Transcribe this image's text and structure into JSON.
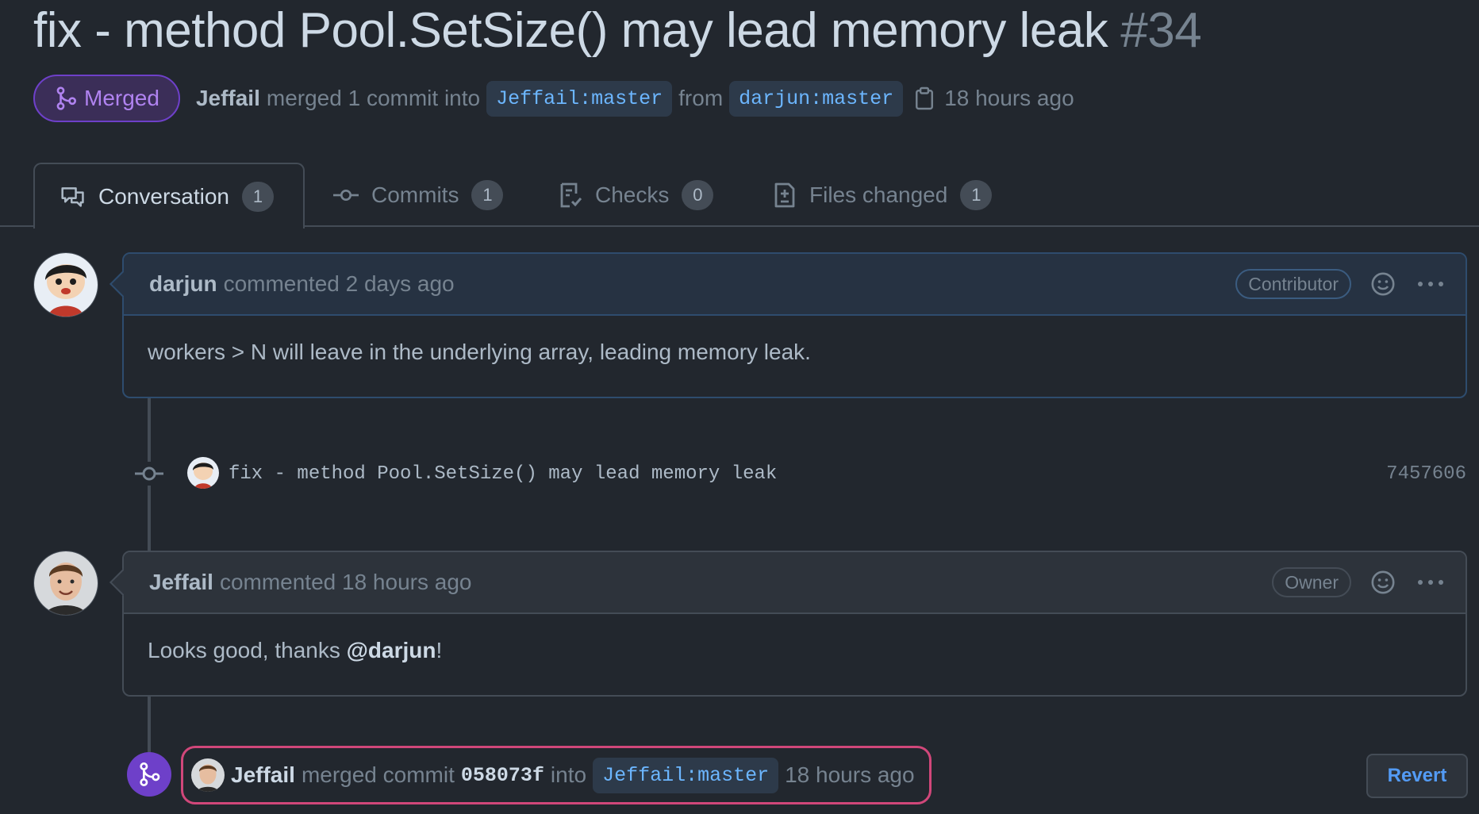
{
  "pr": {
    "title": "fix - method Pool.SetSize() may lead memory leak",
    "number": "#34",
    "state": "Merged",
    "author": "Jeffail",
    "merge_text": "merged 1 commit into",
    "base_branch": "Jeffail:master",
    "from_text": "from",
    "head_branch": "darjun:master",
    "time": "18 hours ago"
  },
  "tabs": [
    {
      "label": "Conversation",
      "count": "1",
      "icon": "comment-discussion-icon"
    },
    {
      "label": "Commits",
      "count": "1",
      "icon": "git-commit-icon"
    },
    {
      "label": "Checks",
      "count": "0",
      "icon": "checklist-icon"
    },
    {
      "label": "Files changed",
      "count": "1",
      "icon": "file-diff-icon"
    }
  ],
  "comments": [
    {
      "author": "darjun",
      "action": "commented 2 days ago",
      "role": "Contributor",
      "body": "workers > N will leave in the underlying array, leading memory leak."
    },
    {
      "author": "Jeffail",
      "action": "commented 18 hours ago",
      "role": "Owner",
      "body_prefix": "Looks good, thanks ",
      "mention": "@darjun",
      "body_suffix": "!"
    }
  ],
  "commit": {
    "message": "fix - method Pool.SetSize() may lead memory leak",
    "sha": "7457606"
  },
  "merge_event": {
    "actor": "Jeffail",
    "text": "merged commit",
    "sha": "058073f",
    "into": "into",
    "branch": "Jeffail:master",
    "time": "18 hours ago",
    "revert_label": "Revert"
  },
  "colors": {
    "background": "#22272e",
    "merged_purple": "#6e40c9",
    "link_blue": "#6cb6ff",
    "highlight_pink": "#d1477a"
  }
}
